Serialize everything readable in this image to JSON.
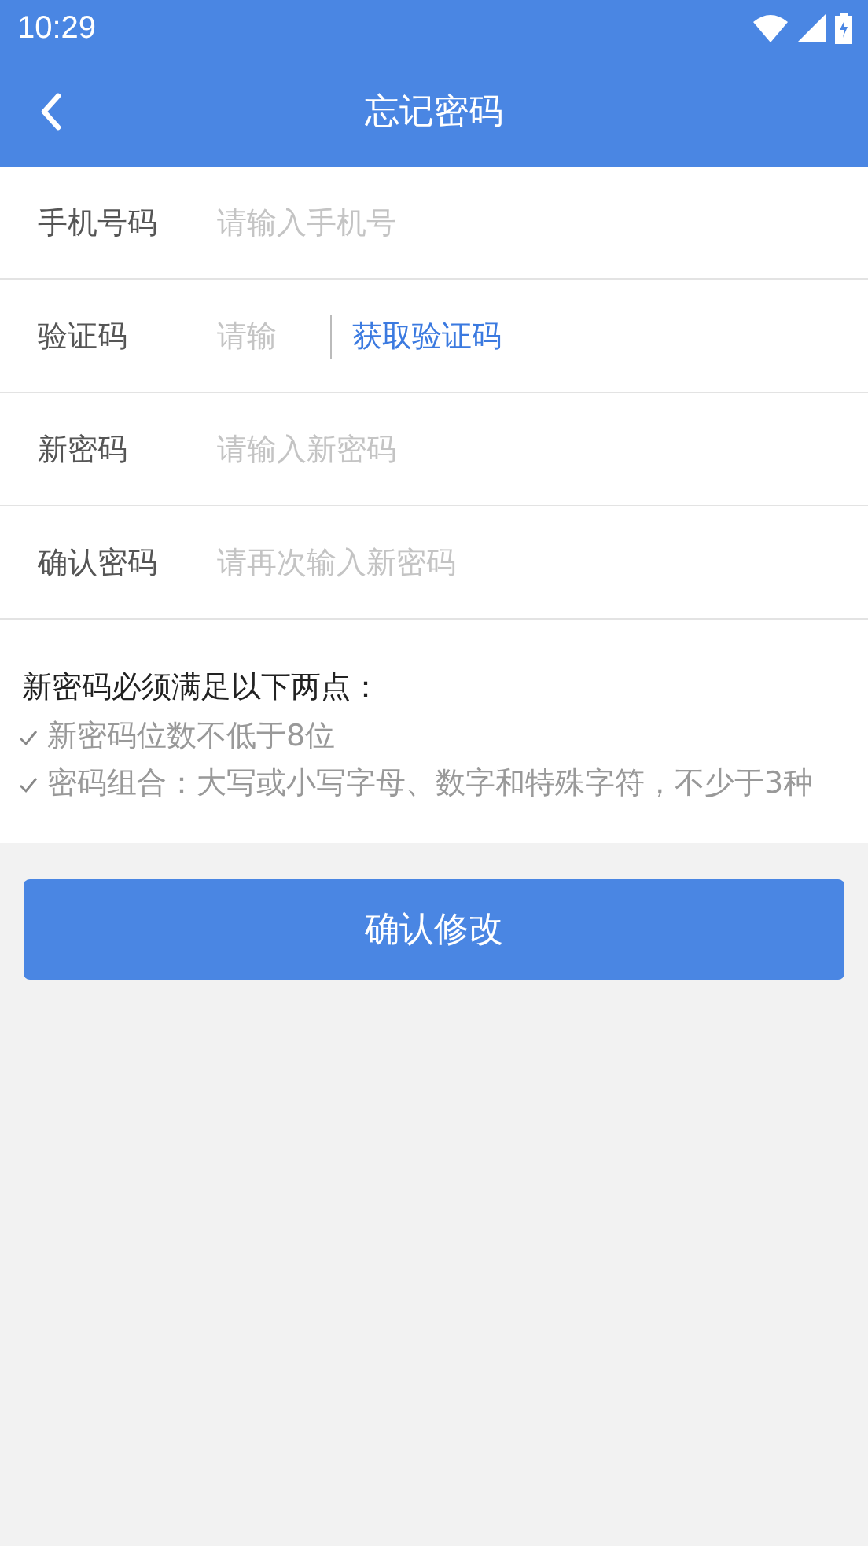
{
  "status_bar": {
    "time": "10:29"
  },
  "header": {
    "title": "忘记密码"
  },
  "fields": [
    {
      "kind": "text",
      "label": "手机号码",
      "placeholder": "请输入手机号"
    },
    {
      "kind": "code",
      "label": "验证码",
      "placeholder": "请输",
      "action": "获取验证码"
    },
    {
      "kind": "text",
      "label": "新密码",
      "placeholder": "请输入新密码"
    },
    {
      "kind": "text",
      "label": "确认密码",
      "placeholder": "请再次输入新密码"
    }
  ],
  "rules": {
    "title": "新密码必须满足以下两点：",
    "items": [
      "新密码位数不低于8位",
      "密码组合：大写或小写字母、数字和特殊字符，不少于3种"
    ]
  },
  "submit": {
    "label": "确认修改"
  }
}
